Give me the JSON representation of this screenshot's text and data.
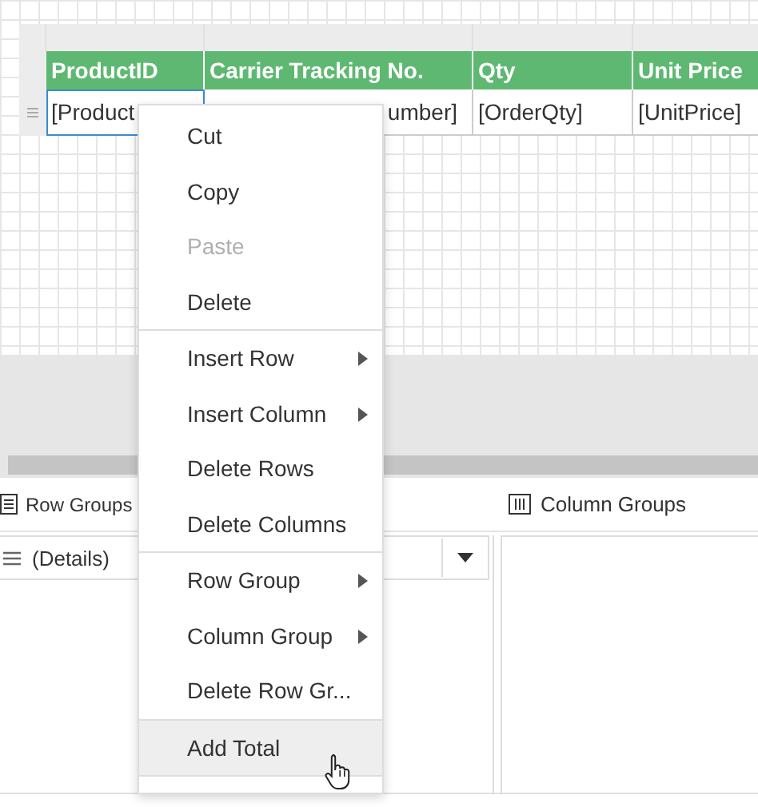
{
  "table": {
    "columns": [
      {
        "label": "ProductID"
      },
      {
        "label": "Carrier Tracking No."
      },
      {
        "label": "Qty"
      },
      {
        "label": "Unit Price"
      }
    ],
    "row": [
      {
        "text": "[Product",
        "selected": true
      },
      {
        "text": "umber]",
        "selected": false
      },
      {
        "text": "[OrderQty]",
        "selected": false
      },
      {
        "text": "[UnitPrice]",
        "selected": false
      }
    ]
  },
  "context_menu": [
    {
      "kind": "item",
      "label": "Cut",
      "disabled": false,
      "submenu": false,
      "hovered": false
    },
    {
      "kind": "item",
      "label": "Copy",
      "disabled": false,
      "submenu": false,
      "hovered": false
    },
    {
      "kind": "item",
      "label": "Paste",
      "disabled": true,
      "submenu": false,
      "hovered": false
    },
    {
      "kind": "item",
      "label": "Delete",
      "disabled": false,
      "submenu": false,
      "hovered": false
    },
    {
      "kind": "separator"
    },
    {
      "kind": "item",
      "label": "Insert Row",
      "disabled": false,
      "submenu": true,
      "hovered": false
    },
    {
      "kind": "item",
      "label": "Insert Column",
      "disabled": false,
      "submenu": true,
      "hovered": false
    },
    {
      "kind": "item",
      "label": "Delete Rows",
      "disabled": false,
      "submenu": false,
      "hovered": false
    },
    {
      "kind": "item",
      "label": "Delete Columns",
      "disabled": false,
      "submenu": false,
      "hovered": false
    },
    {
      "kind": "separator"
    },
    {
      "kind": "item",
      "label": "Row Group",
      "disabled": false,
      "submenu": true,
      "hovered": false
    },
    {
      "kind": "item",
      "label": "Column Group",
      "disabled": false,
      "submenu": true,
      "hovered": false
    },
    {
      "kind": "item",
      "label": "Delete Row Gr...",
      "disabled": false,
      "submenu": false,
      "hovered": false
    },
    {
      "kind": "separator"
    },
    {
      "kind": "item",
      "label": "Add Total",
      "disabled": false,
      "submenu": false,
      "hovered": true
    },
    {
      "kind": "separator"
    }
  ],
  "row_groups": {
    "title": "Row Groups",
    "items": [
      {
        "label": "(Details)"
      }
    ]
  },
  "column_groups": {
    "title": "Column Groups"
  }
}
